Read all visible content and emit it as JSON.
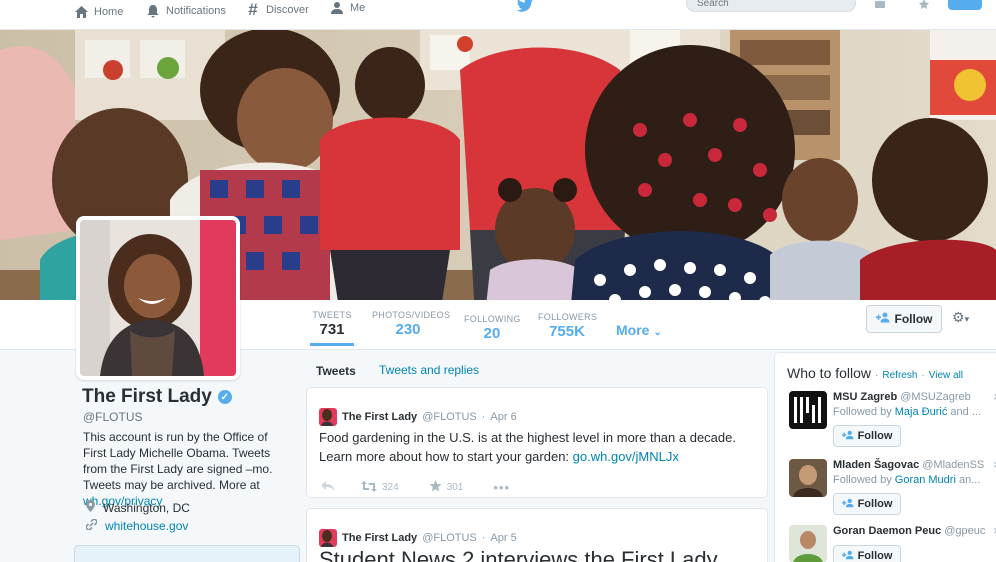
{
  "nav": {
    "home": "Home",
    "notifications": "Notifications",
    "discover": "Discover",
    "me": "Me",
    "search_placeholder": "Search"
  },
  "profile": {
    "name": "The First Lady",
    "handle": "@FLOTUS",
    "bio_text": "This account is run by the Office of First Lady Michelle Obama. Tweets from the First Lady are signed –mo. Tweets may be archived. More at ",
    "bio_link": "wh.gov/privacy",
    "location": "Washington, DC",
    "website": "whitehouse.gov"
  },
  "stats": [
    {
      "label": "TWEETS",
      "value": "731"
    },
    {
      "label": "PHOTOS/VIDEOS",
      "value": "230"
    },
    {
      "label": "FOLLOWING",
      "value": "20"
    },
    {
      "label": "FOLLOWERS",
      "value": "755K"
    }
  ],
  "more_label": "More",
  "follow_label": "Follow",
  "tabs": {
    "tweets": "Tweets",
    "tweets_and_replies": "Tweets and replies"
  },
  "tweets": [
    {
      "name": "The First Lady",
      "handle": "@FLOTUS",
      "date": "Apr 6",
      "text": "Food gardening in the U.S. is at the highest level in more than a decade. Learn more about how to start your garden: ",
      "link": "go.wh.gov/jMNLJx",
      "retweets": "324",
      "favorites": "301"
    },
    {
      "name": "The First Lady",
      "handle": "@FLOTUS",
      "date": "Apr 5",
      "text": "Student News 2 interviews the First Lady"
    }
  ],
  "who_to_follow": {
    "title": "Who to follow",
    "refresh": "Refresh",
    "view_all": "View all",
    "followed_by_prefix": "Followed by",
    "suggestions": [
      {
        "name": "MSU Zagreb",
        "handle": "@MSUZagreb",
        "followed_by": "Maja Đurić",
        "followed_suffix": "and ..."
      },
      {
        "name": "Mladen Šagovac",
        "handle": "@MladenSS",
        "followed_by": "Goran Mudri",
        "followed_suffix": "an..."
      },
      {
        "name": "Goran Daemon Peuc",
        "handle": "@gpeuc",
        "followed_by": "",
        "followed_suffix": ""
      }
    ]
  },
  "colors": {
    "accent": "#55acee",
    "link": "#0084b4"
  }
}
